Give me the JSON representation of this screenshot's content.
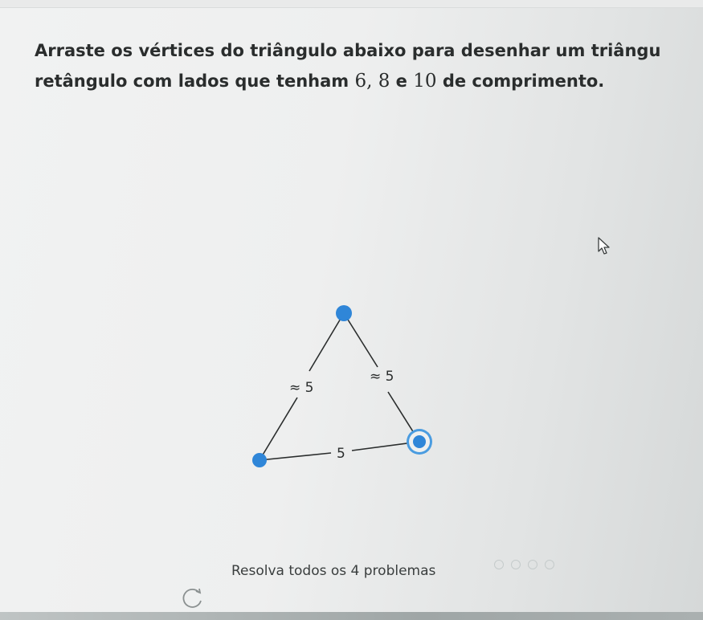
{
  "instruction": {
    "line1": "Arraste os vértices do triângulo abaixo para desenhar um triângu",
    "line2_pre": "retângulo com lados que tenham ",
    "line2_math": "6, 8",
    "line2_and": " e ",
    "line2_math2": "10",
    "line2_post": " de comprimento."
  },
  "triangle": {
    "side_left_label": "≈ 5",
    "side_right_label": "≈ 5",
    "side_bottom_label": "5"
  },
  "footer": {
    "status_text": "Resolva todos os 4 problemas",
    "problems_total": 4,
    "problems_done": 0
  },
  "icons": {
    "cursor": "mouse-pointer-icon",
    "reset": "reset-arrow-icon"
  },
  "colors": {
    "vertex": "#2f86d8",
    "edge": "#2a2d2d",
    "background": "#eeefef"
  }
}
